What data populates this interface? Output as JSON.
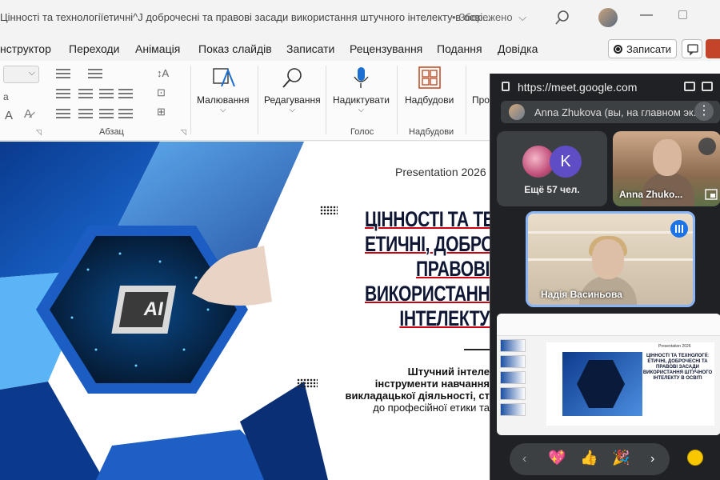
{
  "titlebar": {
    "doc_title": "Цінності та технологіїетичні^J доброчесні та правові засади використання штучного інтелекту в осві...",
    "saved_status": "Збережено"
  },
  "menubar": {
    "items": [
      "нструктор",
      "Переходи",
      "Анімація",
      "Показ слайдів",
      "Записати",
      "Рецензування",
      "Подання",
      "Довідка"
    ],
    "record_button": "Записати"
  },
  "ribbon": {
    "paragraph_group": "Абзац",
    "drawing": "Малювання",
    "editing": "Редагування",
    "dictate": "Надиктувати",
    "voice_group": "Голос",
    "addins": "Надбудови",
    "addins_group": "Надбудови",
    "truncated": "Про"
  },
  "slide": {
    "year": "Presentation 2026",
    "title_lines": [
      "ЦІННОСТІ ТА ТЕХ",
      "ЕТИЧНІ, ДОБРО",
      "ПРАВОВІ",
      "ВИКОРИСТАННЯ ШТ",
      "ІНТЕЛЕКТУ"
    ],
    "subtitle_lines": [
      "Штучний інтеле",
      "інструменти навчання",
      "викладацької діяльності, ст",
      "до професійної етики та"
    ],
    "chip_label": "AI"
  },
  "meet": {
    "url": "https://meet.google.com",
    "presenter": "Anna Zhukova (вы, на главном эк...",
    "more_tile_initial": "K",
    "more_tile_text": "Ещё 57 чел.",
    "anna_label": "Anna Zhuko...",
    "nadia_label": "Надія Васиньова",
    "mini_year": "Presentation 2026",
    "mini_title": "ЦІННОСТІ ТА ТЕХНОЛОГІЇ: ЕТИЧНІ, ДОБРОЧЕСНІ ТА ПРАВОВІ ЗАСАДИ ВИКОРИСТАННЯ ШТУЧНОГО ІНТЕЛЕКТУ В ОСВІТІ",
    "reactions": [
      "💖",
      "👍",
      "🎉"
    ]
  },
  "colors": {
    "accent_red": "#c01010",
    "meet_bg": "#202124",
    "slide_blue": "#0d4bb0",
    "speaking_blue": "#1a73e8"
  }
}
